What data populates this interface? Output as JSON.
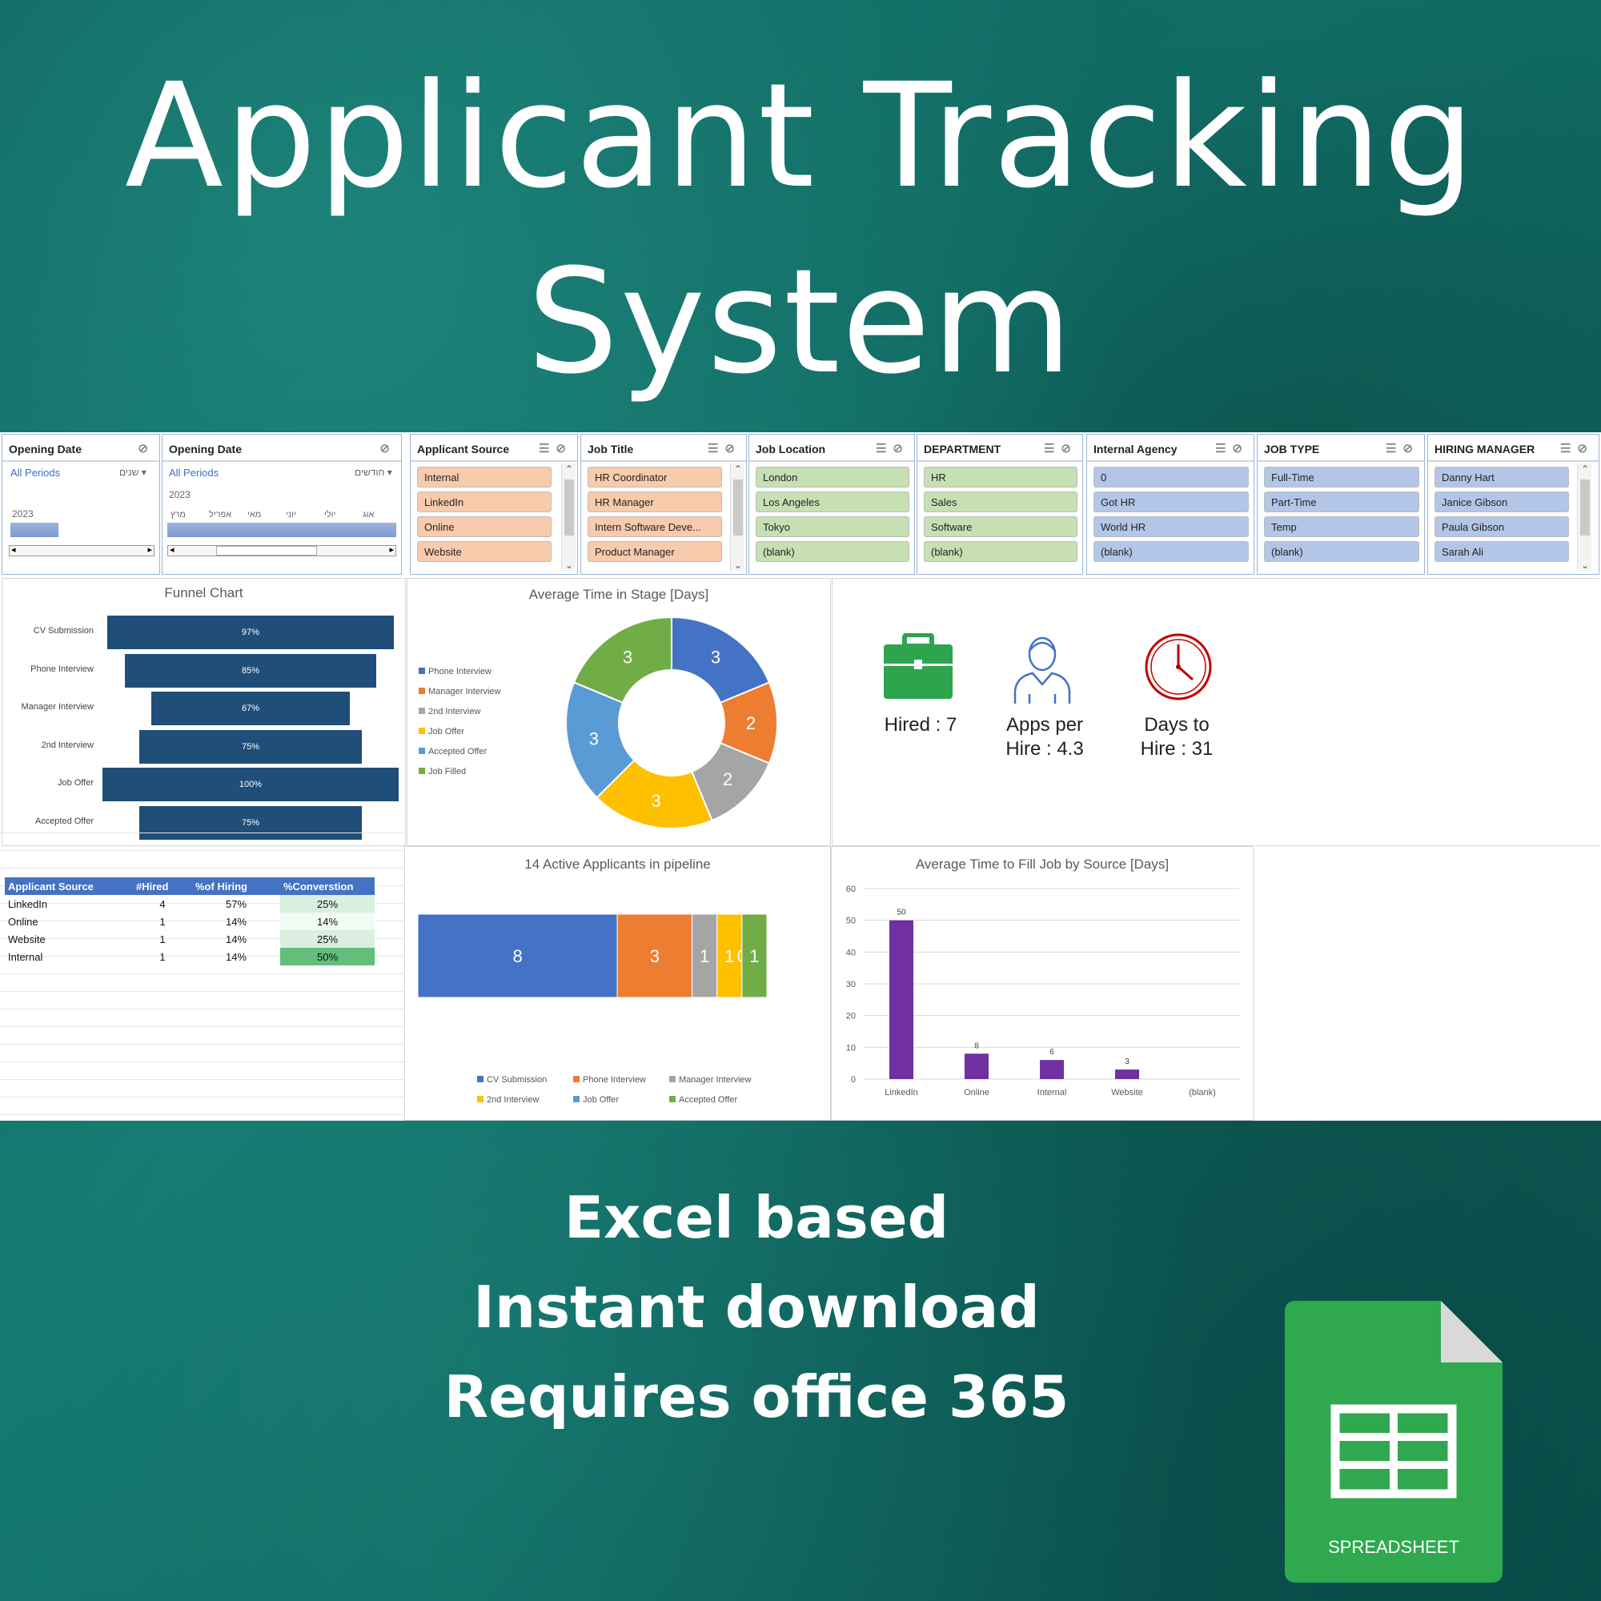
{
  "hero": {
    "line1": "Applicant Tracking",
    "line2": "System"
  },
  "slicers": {
    "opening_date_1": {
      "title": "Opening  Date",
      "selection": "All Periods",
      "level": "שנים",
      "year": "2023"
    },
    "opening_date_2": {
      "title": "Opening  Date",
      "selection": "All Periods",
      "level": "חודשים",
      "year": "2023",
      "months": [
        "מרץ",
        "אפריל",
        "מאי",
        "יוני",
        "יולי",
        "אוג"
      ]
    },
    "applicant_source": {
      "title": "Applicant Source",
      "items": [
        "Internal",
        "LinkedIn",
        "Online",
        "Website"
      ]
    },
    "job_title": {
      "title": "Job Title",
      "items": [
        "HR Coordinator",
        "HR Manager",
        "Intern Software Deve...",
        "Product Manager"
      ]
    },
    "job_location": {
      "title": "Job Location",
      "items": [
        "London",
        "Los Angeles",
        "Tokyo",
        "(blank)"
      ]
    },
    "department": {
      "title": "DEPARTMENT",
      "items": [
        "HR",
        "Sales",
        "Software",
        "(blank)"
      ]
    },
    "internal_agency": {
      "title": "Internal Agency",
      "items": [
        "0",
        "Got HR",
        "World HR",
        "(blank)"
      ]
    },
    "job_type": {
      "title": "JOB TYPE",
      "items": [
        "Full-Time",
        "Part-Time",
        "Temp",
        "(blank)"
      ]
    },
    "hiring_manager": {
      "title": "HIRING MANAGER",
      "items": [
        "Danny Hart",
        "Janice Gibson",
        "Paula Gibson",
        "Sarah Ali"
      ]
    }
  },
  "colors": {
    "slicer_orange": "#f8cbad",
    "slicer_green": "#c6e0b4",
    "slicer_blue": "#b4c6e7",
    "funnel": "#1f4e79",
    "bar_purple": "#7030a0",
    "kpi_green": "#2ea44f",
    "kpi_blue": "#4472c4",
    "kpi_red": "#c00000",
    "header_blue": "#4472c4"
  },
  "chart_data": [
    {
      "type": "bar",
      "title": "Funnel Chart",
      "categories": [
        "CV Submission",
        "Phone Interview",
        "Manager Interview",
        "2nd Interview",
        "Job Offer",
        "Accepted Offer"
      ],
      "values": [
        97,
        85,
        67,
        75,
        100,
        75
      ],
      "labels": [
        "97%",
        "85%",
        "67%",
        "75%",
        "100%",
        "75%"
      ],
      "unit": "%"
    },
    {
      "type": "pie",
      "title": "Average Time in Stage [Days]",
      "categories": [
        "Phone Interview",
        "Manager Interview",
        "2nd Interview",
        "Job Offer",
        "Accepted Offer",
        "Job Filled"
      ],
      "values": [
        3,
        2,
        2,
        3,
        3,
        3
      ],
      "colors": [
        "#4472c4",
        "#ed7d31",
        "#a5a5a5",
        "#ffc000",
        "#5b9bd5",
        "#70ad47"
      ],
      "legend": "left"
    },
    {
      "type": "bar",
      "title": "14 Active Applicants in pipeline",
      "stacked": true,
      "series": [
        {
          "name": "CV Submission",
          "values": [
            8
          ]
        },
        {
          "name": "Phone Interview",
          "values": [
            3
          ]
        },
        {
          "name": "Manager Interview",
          "values": [
            1
          ]
        },
        {
          "name": "2nd Interview",
          "values": [
            1
          ]
        },
        {
          "name": "Job Offer",
          "values": [
            0
          ]
        },
        {
          "name": "Accepted Offer",
          "values": [
            1
          ]
        }
      ],
      "colors": [
        "#4472c4",
        "#ed7d31",
        "#a5a5a5",
        "#ffc000",
        "#5b9bd5",
        "#70ad47"
      ],
      "legend": "bottom"
    },
    {
      "type": "bar",
      "title": "Average Time to Fill Job by Source [Days]",
      "categories": [
        "LinkedIn",
        "Online",
        "Internal",
        "Website",
        "(blank)"
      ],
      "values": [
        50,
        8,
        6,
        3,
        null
      ],
      "ylim": [
        0,
        60
      ],
      "yticks": [
        0,
        10,
        20,
        30,
        40,
        50,
        60
      ],
      "grid": true
    }
  ],
  "kpis": {
    "hired": "Hired : 7",
    "apps_line1": "Apps per",
    "apps_line2": "Hire : 4.3",
    "days_line1": "Days to",
    "days_line2": "Hire : 31"
  },
  "source_table": {
    "headers": [
      "Applicant Source",
      "#Hired",
      "%of Hiring",
      "%Converstion"
    ],
    "rows": [
      [
        "LinkedIn",
        "4",
        "57%",
        "25%"
      ],
      [
        "Online",
        "1",
        "14%",
        "14%"
      ],
      [
        "Website",
        "1",
        "14%",
        "25%"
      ],
      [
        "Internal",
        "1",
        "14%",
        "50%"
      ]
    ],
    "conversion_colors": [
      "#d9efe0",
      "#f2faf4",
      "#d9efe0",
      "#63be7b"
    ]
  },
  "footer": {
    "line1": "Excel based",
    "line2": "Instant download",
    "line3": "Requires office 365",
    "icon_label": "SPREADSHEET"
  }
}
